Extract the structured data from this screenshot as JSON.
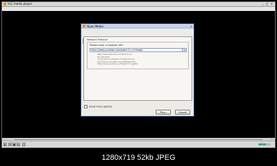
{
  "window": {
    "title": "VLC media player",
    "window_buttons": "_ □ ×"
  },
  "menu": [
    "Media",
    "Playback",
    "Audio",
    "Video",
    "Subtitle",
    "Tools",
    "View",
    "Help"
  ],
  "dialog": {
    "title": "Open Media",
    "close": "×",
    "tabs": [
      "File",
      "Disc",
      "Network",
      "Capture Device"
    ],
    "active_tab": "Network",
    "group_label": "Network Protocol",
    "prompt": "Please enter a network URL:",
    "url_value": "https://www.youtube.com/watch?v=n1ntdg0s",
    "url_arrow": "▾",
    "examples": [
      "http://www.example.com/stream.avi",
      "rtp://@:1234",
      "mms://mms.examples.com/stream.asx",
      "rtsp://server.example.org:8080/test.sdp",
      "http://www.yourtube.com/watch?v=gg64x"
    ],
    "show_more": "Show more options",
    "play_label": "Play",
    "play_dropdown": "▾",
    "cancel_label": "Cancel"
  },
  "player": {
    "time_left": "--:--",
    "time_right": "--:--",
    "volume_fraction": 0.6,
    "accent": "#ff8800"
  },
  "caption": "1280x719  52kb  JPEG"
}
